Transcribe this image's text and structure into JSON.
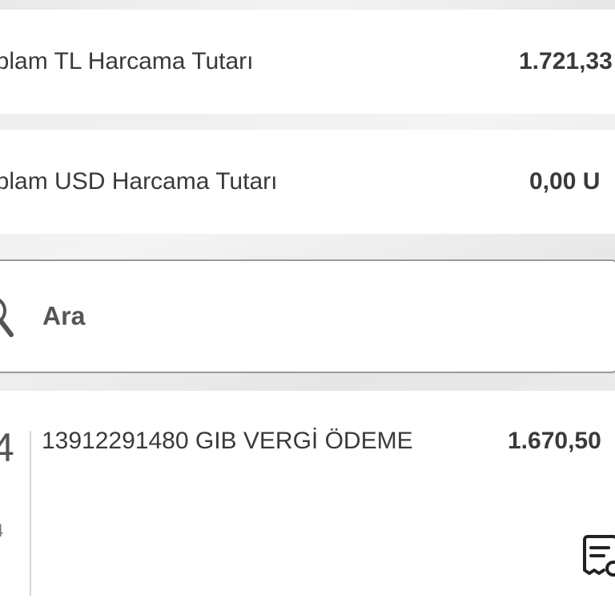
{
  "summary": {
    "tl": {
      "label": "oplam TL Harcama Tutarı",
      "value": "1.721,33"
    },
    "usd": {
      "label": "oplam USD Harcama Tutarı",
      "value": "0,00 U"
    }
  },
  "search": {
    "text": "Ara",
    "icon": "search-icon"
  },
  "transaction": {
    "day": "4",
    "month": "4",
    "description": "13912291480 GIB VERGİ ÖDEME",
    "amount": "1.670,50",
    "receipt_icon": "receipt-icon"
  }
}
